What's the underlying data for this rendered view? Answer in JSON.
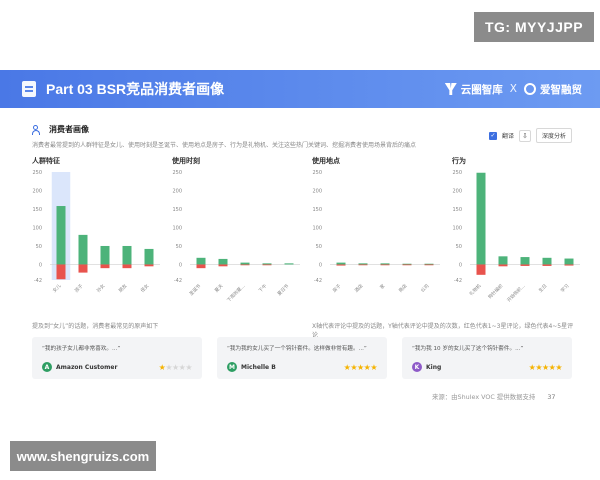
{
  "watermark_top": "TG: MYYJJPP",
  "watermark_bottom": "www.shengruizs.com",
  "header": {
    "title": "Part 03  BSR竞品消费者画像",
    "brand_a": "云圈智库",
    "separator": "X",
    "brand_b": "爱智融贸"
  },
  "card": {
    "title": "消费者画像",
    "description": "消费者最常提到的人群特征是女儿、使用时刻是圣诞节、使用地点是房子、行为是礼物机、关注这些热门关键词、挖掘消费者使用场景背后的痛点",
    "translate_label": "翻译",
    "analysis_button": "深度分析"
  },
  "panels": [
    {
      "title": "人群特征"
    },
    {
      "title": "使用时刻"
    },
    {
      "title": "使用地点"
    },
    {
      "title": "行为"
    }
  ],
  "notes": {
    "left": "提及到“女儿”的话题，消费者最常见的原声如下",
    "right": "X轴代表评论中提及的话题，Y轴代表评论中提及的次数，红色代表1~3星评论，绿色代表4~5星评论"
  },
  "reviews": [
    {
      "quote": "“我的孩子女儿都非常喜欢。...”",
      "user": "Amazon Customer",
      "avatar_letter": "A",
      "avatar_color": "#2e9e63",
      "stars": 1
    },
    {
      "quote": "“我为我的女儿买了一个钩针套件。这样做非常有趣。...”",
      "user": "Michelle B",
      "avatar_letter": "M",
      "avatar_color": "#2e9e63",
      "stars": 5
    },
    {
      "quote": "“我为我 10 岁的女儿买了这个钩针套件。...”",
      "user": "King",
      "avatar_letter": "K",
      "avatar_color": "#8e5ac8",
      "stars": 5
    }
  ],
  "footer": {
    "source": "来源：由Shulex VOC 提供数据支持",
    "page": "37"
  },
  "colors": {
    "positive": "#4db37a",
    "negative": "#e8534d",
    "highlight": "#dbe6fb",
    "header_start": "#4a78e6",
    "header_end": "#6d9bf2"
  },
  "chart_data": [
    {
      "type": "bar",
      "title": "人群特征",
      "categories": [
        "女儿",
        "孩子",
        "孙女",
        "朋友",
        "侄女"
      ],
      "series": [
        {
          "name": "4~5星",
          "values": [
            158,
            80,
            50,
            50,
            42
          ]
        },
        {
          "name": "1~3星",
          "values": [
            -40,
            -22,
            -10,
            -10,
            -5
          ]
        }
      ],
      "ylim": [
        -42,
        250
      ],
      "yticks": [
        250,
        200,
        150,
        100,
        50,
        0,
        -42
      ],
      "highlight_category": "女儿"
    },
    {
      "type": "bar",
      "title": "使用时刻",
      "categories": [
        "圣诞节",
        "夏天",
        "下雨的夏...",
        "下午",
        "夏日节"
      ],
      "series": [
        {
          "name": "4~5星",
          "values": [
            18,
            15,
            5,
            3,
            3
          ]
        },
        {
          "name": "1~3星",
          "values": [
            -10,
            -5,
            -1,
            -1,
            0
          ]
        }
      ],
      "ylim": [
        -42,
        250
      ],
      "yticks": [
        250,
        200,
        150,
        100,
        50,
        0,
        -42
      ]
    },
    {
      "type": "bar",
      "title": "使用地点",
      "categories": [
        "房子",
        "酒店",
        "家",
        "商店",
        "公司"
      ],
      "series": [
        {
          "name": "4~5星",
          "values": [
            5,
            3,
            3,
            2,
            2
          ]
        },
        {
          "name": "1~3星",
          "values": [
            -3,
            -1,
            -1,
            -1,
            -1
          ]
        }
      ],
      "ylim": [
        -42,
        250
      ],
      "yticks": [
        250,
        200,
        150,
        100,
        50,
        0,
        -42
      ]
    },
    {
      "type": "bar",
      "title": "行为",
      "categories": [
        "礼物机",
        "钩针编织",
        "开始钩织...",
        "生日",
        "学习"
      ],
      "series": [
        {
          "name": "4~5星",
          "values": [
            248,
            22,
            20,
            18,
            16
          ]
        },
        {
          "name": "1~3星",
          "values": [
            -28,
            -5,
            -4,
            -4,
            -3
          ]
        }
      ],
      "ylim": [
        -42,
        250
      ],
      "yticks": [
        250,
        200,
        150,
        100,
        50,
        0,
        -42
      ]
    }
  ]
}
